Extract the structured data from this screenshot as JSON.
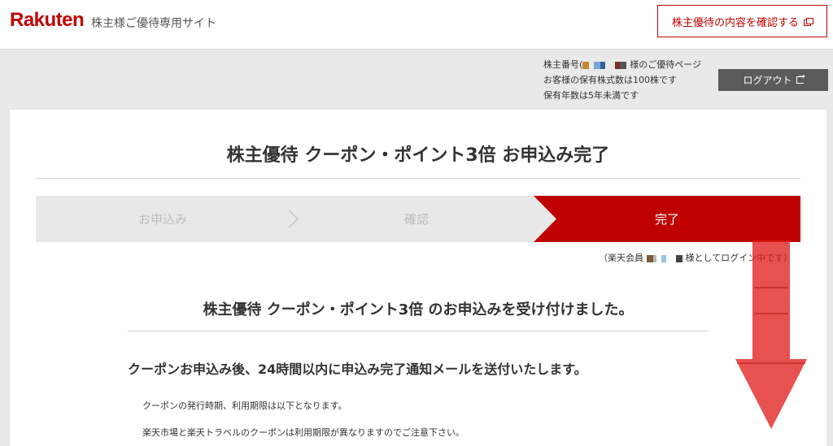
{
  "header": {
    "logo": "Rakuten",
    "site_name": "株主様ご優待専用サイト",
    "confirm_button": "株主優待の内容を確認する"
  },
  "account_info": {
    "line1_prefix": "株主番号(",
    "line1_suffix": "様のご優待ページ",
    "line2": "お客様の保有株式数は100株です",
    "line3": "保有年数は5年未満です",
    "logout_button": "ログアウト"
  },
  "main": {
    "title": "株主優待 クーポン・ポイント3倍 お申込み完了",
    "steps": [
      {
        "label": "お申込み",
        "state": "done"
      },
      {
        "label": "確認",
        "state": "done"
      },
      {
        "label": "完了",
        "state": "active"
      }
    ],
    "member_prefix": "（楽天会員",
    "member_suffix": "様としてログイン中です）",
    "received_heading": "株主優待 クーポン・ポイント3倍 のお申込みを受け付けました。",
    "notice_heading": "クーポンお申込み後、24時間以内に申込み完了通知メールを送付いたします。",
    "paragraphs": [
      "クーポンの発行時期、利用期限は以下となります。",
      "楽天市場と楽天トラベルのクーポンは利用期限が異なりますのでご注意下さい。"
    ]
  },
  "colors": {
    "brand": "#bf0000",
    "logout_bg": "#5b5b5b",
    "step_inactive_bg": "#e8e8e8",
    "annotation_arrow": "#e0201e"
  },
  "icons": {
    "external": "external-link-icon",
    "logout": "logout-icon",
    "step_separator": "chevron-right-icon",
    "annotation": "down-arrow-annotation-icon"
  }
}
